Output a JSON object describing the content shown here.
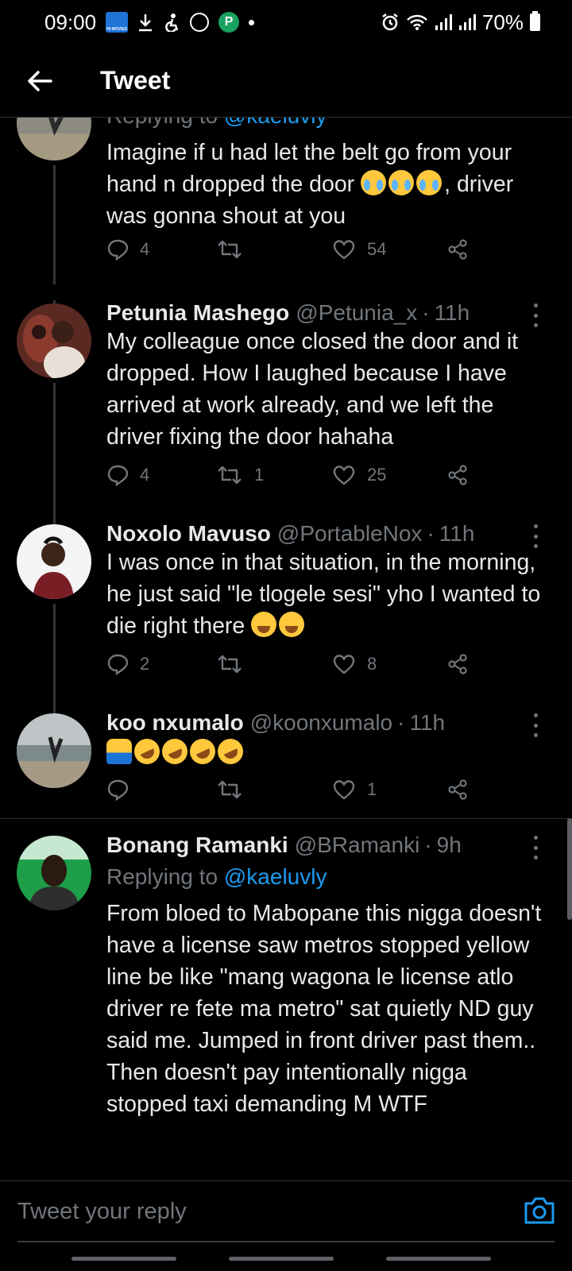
{
  "status_bar": {
    "time": "09:00",
    "hm_label": "HI MOVIES",
    "p_label": "P",
    "battery": "70%",
    "icons": [
      "hi-movies-icon",
      "download-icon",
      "accessibility-icon",
      "messenger-icon",
      "p-app-icon",
      "dot-icon",
      "alarm-icon",
      "wifi-icon",
      "signal-icon",
      "signal-icon",
      "battery-icon"
    ]
  },
  "header": {
    "title": "Tweet",
    "back_icon": "arrow-left-icon"
  },
  "tweets": [
    {
      "reply_context_prefix": "Replying to",
      "reply_context_mention": "@kaeluvly",
      "text": "Imagine if u had let the belt go from your hand n dropped the door",
      "text_after": ", driver was gonna shout at you",
      "emojis": [
        "face-with-tears-of-joy",
        "face-with-tears-of-joy",
        "face-with-tears-of-joy"
      ],
      "replies": "4",
      "retweets": "",
      "likes": "54"
    },
    {
      "name": "Petunia Mashego",
      "handle": "@Petunia_x",
      "sep": "·",
      "time": "11h",
      "text": "My colleague once closed the door and it dropped. How I laughed because I have arrived at work already, and we left the driver fixing the door hahaha",
      "replies": "4",
      "retweets": "1",
      "likes": "25"
    },
    {
      "name": "Noxolo Mavuso",
      "handle": "@PortableNox",
      "sep": "·",
      "time": "11h",
      "text": "I was once in that situation, in the morning, he just said \"le tlogele sesi\" yho I wanted to die right there",
      "emojis": [
        "loudly-crying-face",
        "loudly-crying-face"
      ],
      "replies": "2",
      "retweets": "",
      "likes": "8"
    },
    {
      "name": "koo nxumalo",
      "handle": "@koonxumalo",
      "sep": "·",
      "time": "11h",
      "emojis": [
        "man-facepalming",
        "rolling-on-the-floor-laughing",
        "rolling-on-the-floor-laughing",
        "rolling-on-the-floor-laughing",
        "rolling-on-the-floor-laughing"
      ],
      "replies": "",
      "retweets": "",
      "likes": "1"
    },
    {
      "name": "Bonang Ramanki",
      "handle": "@BRamanki",
      "sep": "·",
      "time": "9h",
      "reply_context_prefix": "Replying to",
      "reply_context_mention": "@kaeluvly",
      "text": "From bloed to Mabopane this nigga doesn't have a license saw metros stopped yellow line be like \"mang wagona le license atlo driver re fete ma metro\" sat quietly ND guy said me. Jumped in front driver past them.. Then doesn't pay intentionally nigga stopped taxi demanding M WTF"
    }
  ],
  "reply_bar": {
    "placeholder": "Tweet your reply",
    "camera_icon": "camera-icon"
  },
  "colors": {
    "background": "#000000",
    "text": "#e7e9ea",
    "muted": "#71767b",
    "accent": "#1d9bf0"
  }
}
